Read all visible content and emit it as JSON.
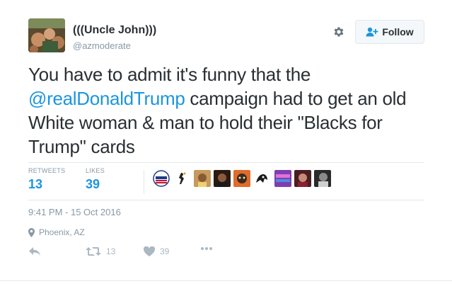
{
  "author": {
    "fullname": "(((Uncle John)))",
    "username": "@azmoderate"
  },
  "follow_button": {
    "label": "Follow"
  },
  "tweet": {
    "text_before": "You have to admit it's funny that the ",
    "mention": "@realDonaldTrump",
    "text_after": " campaign had to get an old White woman & man to hold their \"Blacks for Trump\" cards"
  },
  "stats": {
    "retweets_label": "RETWEETS",
    "retweets_value": "13",
    "likes_label": "LIKES",
    "likes_value": "39"
  },
  "liker_avatars": [
    {
      "name": "i-voted-sticker",
      "color": "#d9d9d9"
    },
    {
      "name": "silhouette",
      "color": "#ffffff"
    },
    {
      "name": "liker-3",
      "color": "#b47a44"
    },
    {
      "name": "liker-4",
      "color": "#6d3b22"
    },
    {
      "name": "liker-5",
      "color": "#c4532d"
    },
    {
      "name": "liker-6",
      "color": "#3a3a3a"
    },
    {
      "name": "liker-7",
      "color": "#b050c8"
    },
    {
      "name": "liker-8",
      "color": "#7a2a30"
    },
    {
      "name": "liker-9",
      "color": "#555555"
    }
  ],
  "timestamp": "9:41 PM - 15 Oct 2016",
  "location": "Phoenix, AZ",
  "actions": {
    "retweet_count": "13",
    "like_count": "39"
  },
  "colors": {
    "link_blue": "#1b95e0",
    "text": "#292f33",
    "muted": "#8899a6",
    "icon_gray": "#aab8c2",
    "border": "#e1e8ed"
  },
  "icons": [
    "gear-icon",
    "follow-person-icon",
    "location-pin-icon",
    "reply-icon",
    "retweet-icon",
    "heart-icon",
    "more-icon"
  ]
}
